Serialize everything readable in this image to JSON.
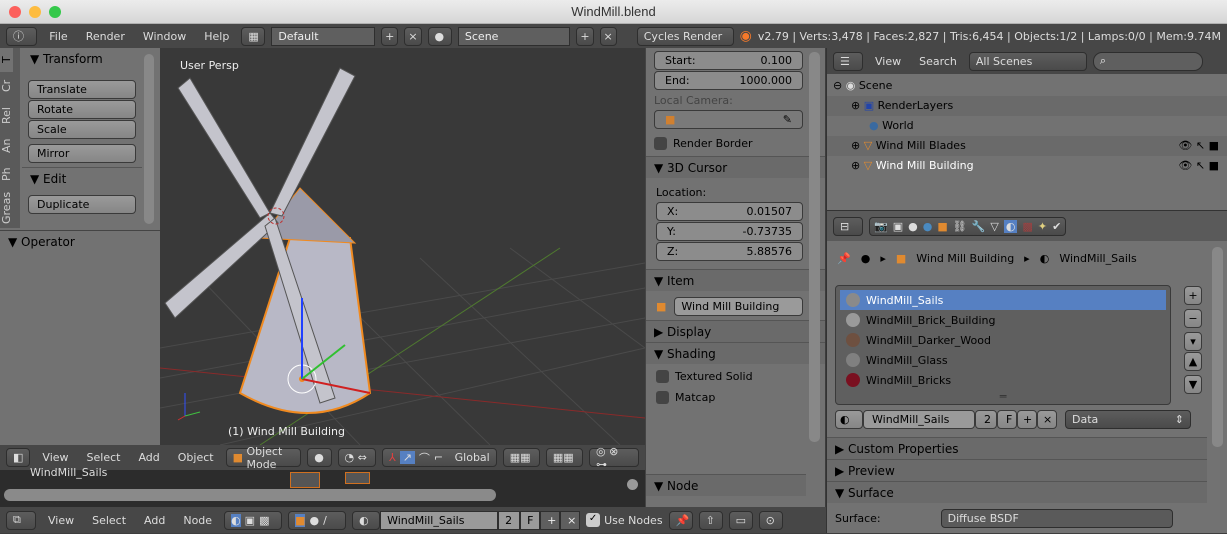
{
  "window": {
    "title": "WindMill.blend"
  },
  "info_header": {
    "menus": [
      "File",
      "Render",
      "Window",
      "Help"
    ],
    "screen_layout": "Default",
    "scene": "Scene",
    "render_engine": "Cycles Render",
    "stats": "v2.79 | Verts:3,478 | Faces:2,827 | Tris:6,454 | Objects:1/2 | Lamps:0/0 | Mem:9.74M"
  },
  "tool_shelf": {
    "tabs": [
      "T",
      "Cr",
      "Rel",
      "An",
      "Ph",
      "Greas"
    ],
    "transform_title": "Transform",
    "transform_buttons": [
      "Translate",
      "Rotate",
      "Scale"
    ],
    "mirror": "Mirror",
    "edit_title": "Edit",
    "duplicate": "Duplicate",
    "operator_title": "Operator"
  },
  "viewport": {
    "view_label": "User Persp",
    "object_label": "(1) Wind Mill Building"
  },
  "n_panel": {
    "start_label": "Start:",
    "start_value": "0.100",
    "end_label": "End:",
    "end_value": "1000.000",
    "local_camera": "Local Camera:",
    "render_border": "Render Border",
    "cursor_title": "3D Cursor",
    "location": "Location:",
    "x_label": "X:",
    "x_value": "0.01507",
    "y_label": "Y:",
    "y_value": "-0.73735",
    "z_label": "Z:",
    "z_value": "5.88576",
    "item_title": "Item",
    "item_name": "Wind Mill Building",
    "display_title": "Display",
    "shading_title": "Shading",
    "textured_solid": "Textured Solid",
    "matcap": "Matcap",
    "node_title": "Node"
  },
  "view3d_header": {
    "menus": [
      "View",
      "Select",
      "Add",
      "Object"
    ],
    "mode": "Object Mode",
    "orientation": "Global"
  },
  "node_editor": {
    "material_label": "WindMill_Sails"
  },
  "node_header": {
    "menus": [
      "View",
      "Select",
      "Add",
      "Node"
    ],
    "material": "WindMill_Sails",
    "users": "2",
    "fake": "F",
    "use_nodes": "Use Nodes"
  },
  "outliner": {
    "menus": [
      "View",
      "Search"
    ],
    "filter": "All Scenes",
    "items": [
      "Scene",
      "RenderLayers",
      "World",
      "Wind Mill Blades",
      "Wind Mill Building"
    ]
  },
  "properties": {
    "breadcrumb": [
      "Wind Mill Building",
      "WindMill_Sails"
    ],
    "materials": [
      "WindMill_Sails",
      "WindMill_Brick_Building",
      "WindMill_Darker_Wood",
      "WindMill_Glass",
      "WindMill_Bricks"
    ],
    "material_colors": [
      "#8a8a8a",
      "#9a9a9a",
      "#6e5040",
      "#808080",
      "#7a1020"
    ],
    "slot_material": "WindMill_Sails",
    "slot_users": "2",
    "slot_fake": "F",
    "link": "Data",
    "custom_properties": "Custom Properties",
    "preview": "Preview",
    "surface_title": "Surface",
    "surface_label": "Surface:",
    "surface_value": "Diffuse BSDF"
  }
}
